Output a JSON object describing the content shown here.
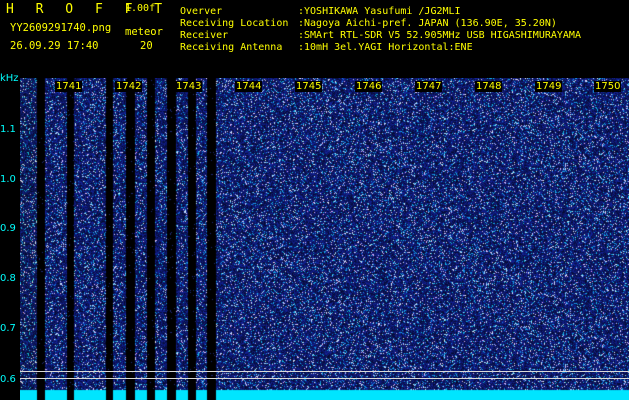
{
  "header": {
    "app_title": "H R O F F T",
    "version": "1.00f",
    "filename": "YY2609291740.png",
    "datetime": "26.09.29 17:40",
    "meteor_label": "meteor",
    "meteor_count": "20"
  },
  "info": [
    {
      "label": "Overver",
      "value": ":YOSHIKAWA Yasufumi /JG2MLI"
    },
    {
      "label": "Receiving Location",
      "value": ":Nagoya Aichi-pref. JAPAN (136.90E, 35.20N)"
    },
    {
      "label": "Receiver",
      "value": ":SMArt RTL-SDR V5 52.905MHz USB HIGASHIMURAYAMA"
    },
    {
      "label": "Receiving Antenna",
      "value": ":10mH 3el.YAGI Horizontal:ENE"
    }
  ],
  "y_axis": {
    "unit": "kHz",
    "ticks": [
      "1.1",
      "1.0",
      "0.9",
      "0.8",
      "0.7",
      "0.6"
    ]
  },
  "x_axis": {
    "ticks": [
      "1741",
      "1742",
      "1743",
      "1744",
      "1745",
      "1746",
      "1747",
      "1748",
      "1749",
      "1750"
    ]
  },
  "colors": {
    "label_yellow": "#ffff00",
    "axis_cyan": "#00ffff",
    "noise_blue": "#1e32c8",
    "background": "#000000"
  }
}
